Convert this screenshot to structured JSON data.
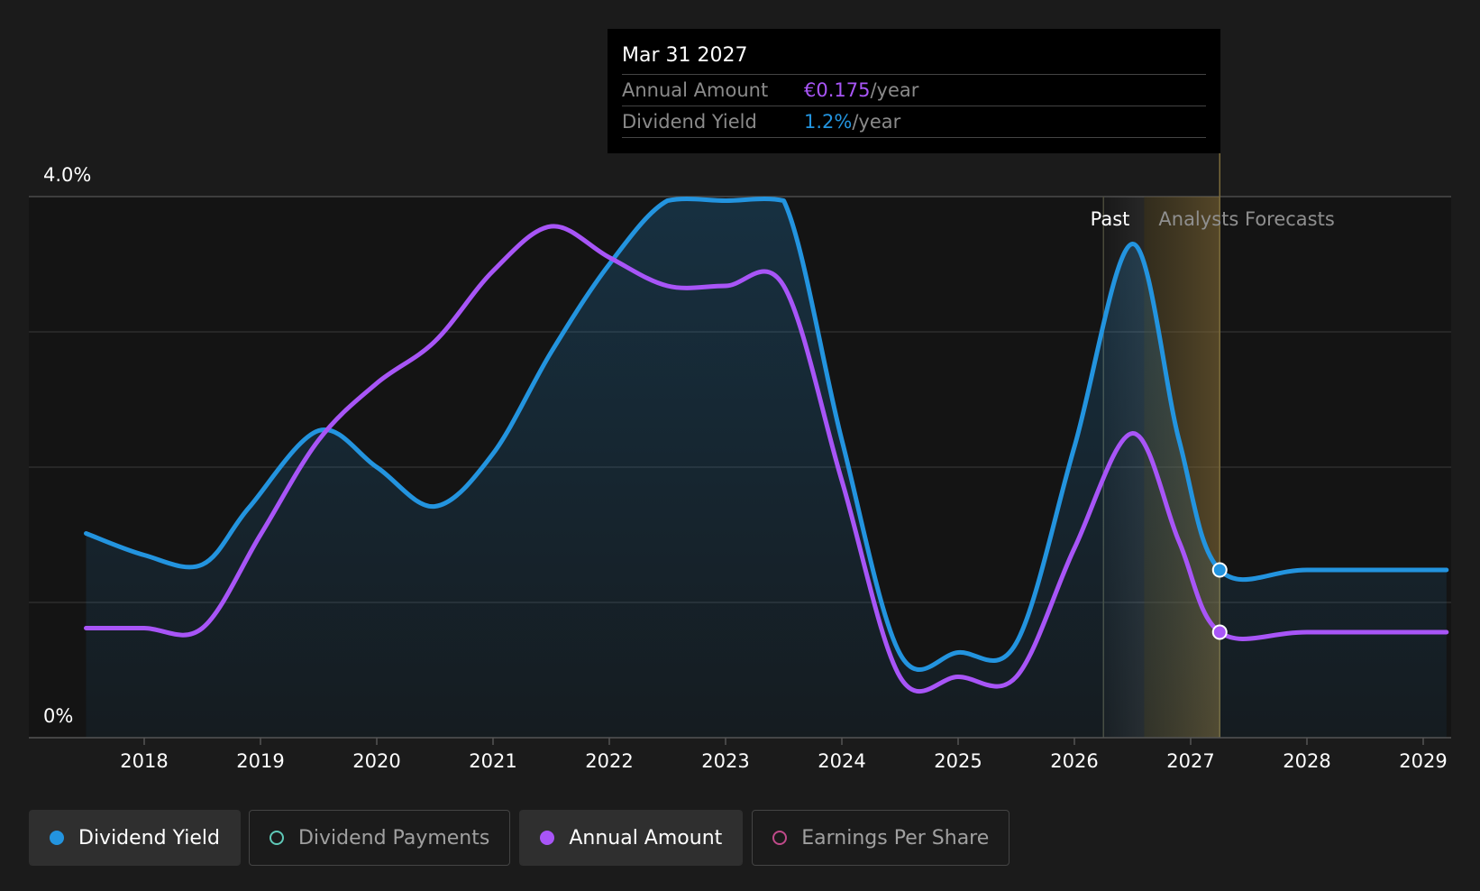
{
  "tooltip": {
    "date": "Mar 31 2027",
    "rows": [
      {
        "label": "Annual Amount",
        "value": "€0.175",
        "unit": "/year",
        "color": "#a855f7"
      },
      {
        "label": "Dividend Yield",
        "value": "1.2%",
        "unit": "/year",
        "color": "#2394df"
      }
    ]
  },
  "legend": [
    {
      "label": "Dividend Yield",
      "color": "#2394df",
      "filled": true,
      "active": true
    },
    {
      "label": "Dividend Payments",
      "color": "#5fc9b8",
      "filled": false,
      "active": false
    },
    {
      "label": "Annual Amount",
      "color": "#a855f7",
      "filled": true,
      "active": true
    },
    {
      "label": "Earnings Per Share",
      "color": "#c04a8a",
      "filled": false,
      "active": false
    }
  ],
  "chart_data": {
    "type": "line",
    "y_axis_labels": [
      "4.0%",
      "0%"
    ],
    "ylim": [
      0,
      4.0
    ],
    "xlim": [
      2017.0,
      2029.2
    ],
    "x_ticks": [
      2018,
      2019,
      2020,
      2021,
      2022,
      2023,
      2024,
      2025,
      2026,
      2027,
      2028,
      2029
    ],
    "grid_values": [
      1.0,
      2.0,
      3.0,
      4.0
    ],
    "past_label": "Past",
    "forecast_label": "Analysts Forecasts",
    "past_start": 2026.25,
    "forecast_start": 2026.6,
    "highlight_x": 2027.25,
    "series": [
      {
        "name": "Dividend Yield",
        "color": "#2394df",
        "fill": true,
        "points": [
          [
            2017.5,
            1.51
          ],
          [
            2018.0,
            1.35
          ],
          [
            2018.5,
            1.28
          ],
          [
            2018.9,
            1.7
          ],
          [
            2019.5,
            2.27
          ],
          [
            2020.0,
            2.0
          ],
          [
            2020.5,
            1.71
          ],
          [
            2021.0,
            2.1
          ],
          [
            2021.5,
            2.85
          ],
          [
            2022.0,
            3.5
          ],
          [
            2022.5,
            3.97
          ],
          [
            2023.0,
            3.97
          ],
          [
            2023.5,
            3.97
          ],
          [
            2024.0,
            2.2
          ],
          [
            2024.5,
            0.62
          ],
          [
            2025.0,
            0.63
          ],
          [
            2025.5,
            0.7
          ],
          [
            2026.0,
            2.15
          ],
          [
            2026.5,
            3.65
          ],
          [
            2026.9,
            2.2
          ],
          [
            2027.25,
            1.24
          ],
          [
            2028.0,
            1.24
          ],
          [
            2029.2,
            1.24
          ]
        ]
      },
      {
        "name": "Annual Amount",
        "color": "#a855f7",
        "fill": false,
        "points": [
          [
            2017.5,
            0.81
          ],
          [
            2018.0,
            0.81
          ],
          [
            2018.5,
            0.81
          ],
          [
            2019.0,
            1.5
          ],
          [
            2019.5,
            2.2
          ],
          [
            2020.0,
            2.62
          ],
          [
            2020.5,
            2.93
          ],
          [
            2021.0,
            3.45
          ],
          [
            2021.5,
            3.78
          ],
          [
            2022.0,
            3.55
          ],
          [
            2022.5,
            3.34
          ],
          [
            2023.0,
            3.34
          ],
          [
            2023.5,
            3.34
          ],
          [
            2024.0,
            1.9
          ],
          [
            2024.5,
            0.45
          ],
          [
            2025.0,
            0.45
          ],
          [
            2025.5,
            0.45
          ],
          [
            2026.0,
            1.4
          ],
          [
            2026.5,
            2.25
          ],
          [
            2026.9,
            1.45
          ],
          [
            2027.25,
            0.78
          ],
          [
            2028.0,
            0.78
          ],
          [
            2029.2,
            0.78
          ]
        ]
      }
    ]
  }
}
